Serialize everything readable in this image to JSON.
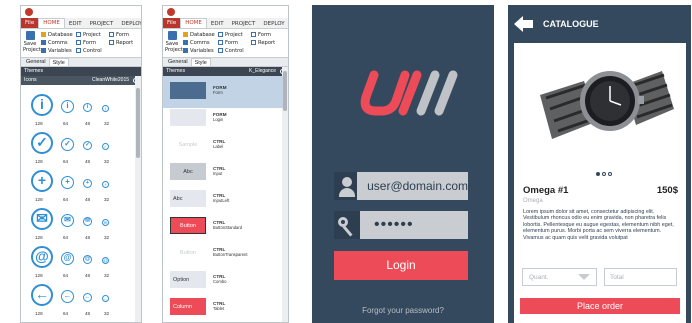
{
  "designer": {
    "menu": [
      "File",
      "HOME",
      "EDIT",
      "PROJECT",
      "DEPLOY"
    ],
    "ribbon": {
      "save": "Save",
      "project": "Project",
      "col1": [
        "Database",
        "Comms",
        "Variables"
      ],
      "col2": [
        "Project",
        "Form",
        "Control"
      ],
      "col3": [
        "Form",
        "Report"
      ]
    },
    "tabs": [
      "General",
      "Style"
    ],
    "themes_label": "Themes",
    "icons_header": "Icons",
    "icons_theme": "CleanWhite2015",
    "controls_theme": "K_Elegance",
    "icon_sizes": [
      "128",
      "64",
      "48",
      "32"
    ],
    "icon_glyphs": [
      "i",
      "✓",
      "+",
      "✉",
      "@",
      "←"
    ],
    "controls": [
      {
        "preview": "",
        "type": "FORM",
        "name": "Form"
      },
      {
        "preview": "",
        "type": "FORM",
        "name": "Login"
      },
      {
        "preview": "Sample",
        "type": "CTRL",
        "name": "Label"
      },
      {
        "preview": "Abc",
        "type": "CTRL",
        "name": "Input"
      },
      {
        "preview": "Abc",
        "type": "CTRL",
        "name": "InputLeft"
      },
      {
        "preview": "Button",
        "type": "CTRL",
        "name": "ButtonStandard"
      },
      {
        "preview": "Button",
        "type": "CTRL",
        "name": "ButtonTransparent"
      },
      {
        "preview": "Option",
        "type": "CTRL",
        "name": "Combo"
      },
      {
        "preview": "Column",
        "type": "CTRL",
        "name": "Tablet"
      }
    ],
    "tablet_sub": "Formula"
  },
  "login": {
    "email": "user@domain.com",
    "password": "••••••",
    "button": "Login",
    "forgot": "Forgot your password?"
  },
  "catalogue": {
    "title": "CATALOGUE",
    "product_name": "Omega #1",
    "price": "150$",
    "subtitle": "Omega",
    "description": "Lorem ipsum dolor sit amet, consectetur adipiscing elit. Vestibulum rhoncus odio eu enim gravida, non pharetra felis lobortis. Pellentesque eu augue egestas, elementum nibh eget, elementum purus. Morbi porta ac sem viverra elementum. Vivamus ac quam quis velit gravida volutpat",
    "quantity_placeholder": "Quant.",
    "total_placeholder": "Total",
    "order_button": "Place order"
  },
  "colors": {
    "accent_red": "#ec4b57",
    "dark_blue": "#34495e",
    "icon_blue": "#2f8fd5"
  }
}
